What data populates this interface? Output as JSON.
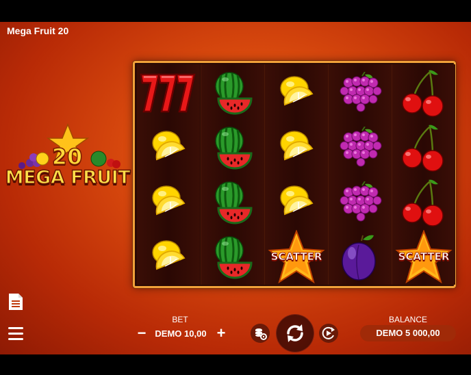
{
  "game": {
    "title": "Mega Fruit 20"
  },
  "logo": {
    "number": "20",
    "text": "MEGA FRUIT"
  },
  "reels": [
    [
      "seven",
      "lemon",
      "lemon",
      "lemon"
    ],
    [
      "watermelon",
      "watermelon",
      "watermelon",
      "watermelon"
    ],
    [
      "lemon",
      "lemon",
      "lemon",
      "scatter"
    ],
    [
      "grapes",
      "grapes",
      "grapes",
      "plum"
    ],
    [
      "cherries",
      "cherries",
      "cherries",
      "scatter"
    ]
  ],
  "symbols": {
    "scatter_label": "SCATTER"
  },
  "controls": {
    "bet_label": "BET",
    "bet_value": "DEMO 10,00",
    "minus": "−",
    "plus": "+",
    "balance_label": "BALANCE",
    "balance_value": "DEMO 5 000,00"
  },
  "side_icons": [
    "paytable-icon",
    "menu-icon"
  ],
  "colors": {
    "accent": "#f2a23a",
    "background": "#d94a0e",
    "balance_bg": "#a02a08"
  }
}
